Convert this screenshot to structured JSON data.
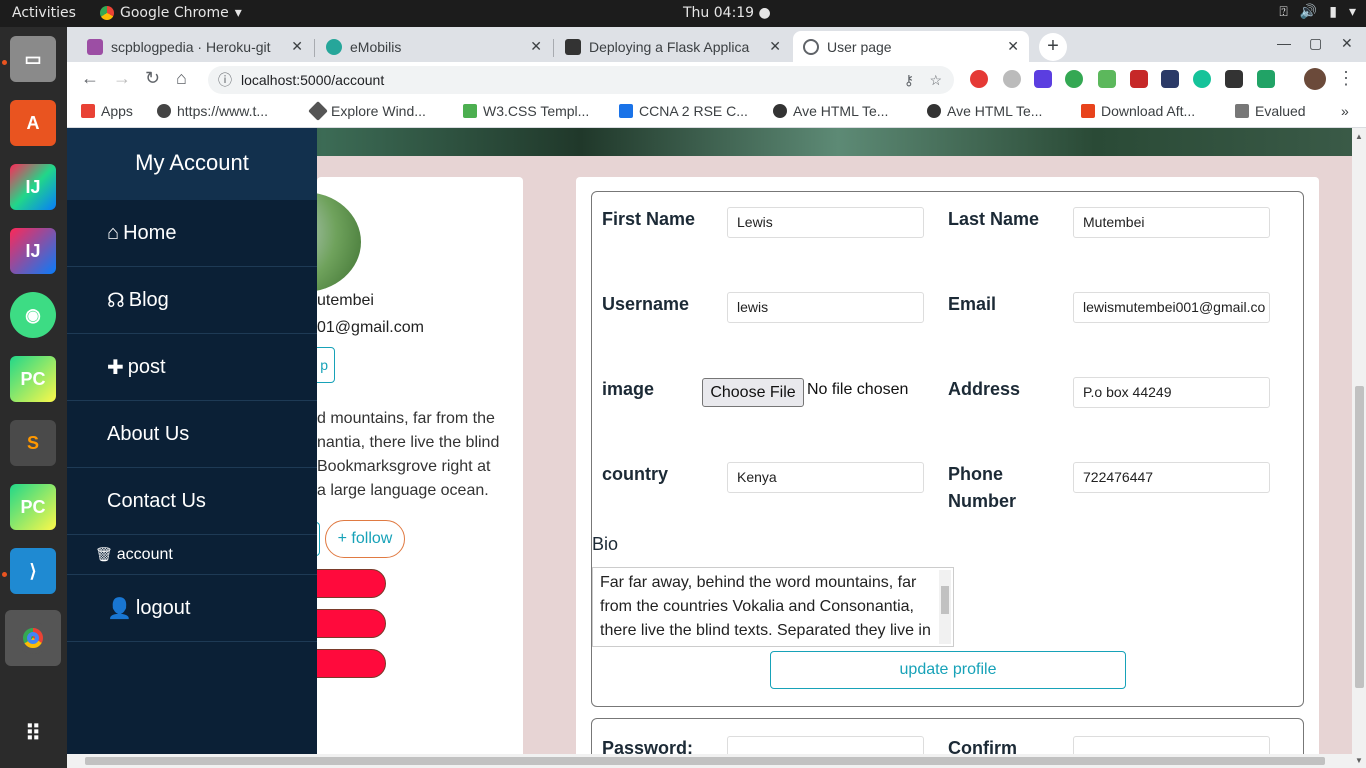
{
  "topbar": {
    "activities": "Activities",
    "app": "Google Chrome",
    "clock": "Thu 04:19"
  },
  "dock": {
    "items": [
      "files-icon",
      "software-center-icon",
      "intellij-icon",
      "intellij-icon-2",
      "android-studio-icon",
      "pycharm-icon",
      "sublime-icon",
      "pycharm-icon-2",
      "vscode-icon",
      "chrome-icon",
      "apps-grid-icon"
    ]
  },
  "tabs": [
    {
      "title": "scpblogpedia · Heroku-git",
      "color": "#9c4ea4"
    },
    {
      "title": "eMobilis",
      "color": "#26a69a"
    },
    {
      "title": "Deploying a Flask Applica",
      "color": "#333333"
    },
    {
      "title": "User page",
      "color": "#5f6368"
    }
  ],
  "address": {
    "url": "localhost:5000/account"
  },
  "bookmarks": [
    {
      "label": "Apps",
      "color": "#e94235"
    },
    {
      "label": "https://www.t...",
      "color": "#444"
    },
    {
      "label": "Explore Wind...",
      "color": "#555"
    },
    {
      "label": "W3.CSS Templ...",
      "color": "#4caf50"
    },
    {
      "label": "CCNA 2 RSE C...",
      "color": "#1a73e8"
    },
    {
      "label": "Ave HTML Te...",
      "color": "#333"
    },
    {
      "label": "Ave HTML Te...",
      "color": "#333"
    },
    {
      "label": "Download Aft...",
      "color": "#e8431c"
    },
    {
      "label": "Evalued",
      "color": "#777"
    }
  ],
  "sidenav": {
    "header": "My Account",
    "items": [
      {
        "label": "Home",
        "icon": "⌂"
      },
      {
        "label": "Blog",
        "icon": "☊"
      },
      {
        "label": "post",
        "icon": "✚"
      },
      {
        "label": "About Us",
        "icon": ""
      },
      {
        "label": "Contact Us",
        "icon": ""
      },
      {
        "label": "account",
        "icon": "🗑"
      },
      {
        "label": "logout",
        "icon": "👤"
      }
    ]
  },
  "profile": {
    "name_fragment": "utembei",
    "email_fragment": "01@gmail.com",
    "button_fragment": "p",
    "bio_lines": [
      "d mountains, far from the",
      "nantia, there live the blind",
      "Bookmarksgrove right at",
      "a large language ocean."
    ],
    "follow": "+ follow"
  },
  "form": {
    "first_name_label": "First Name",
    "first_name": "Lewis",
    "last_name_label": "Last Name",
    "last_name": "Mutembei",
    "username_label": "Username",
    "username": "lewis",
    "email_label": "Email",
    "email": "lewismutembei001@gmail.co",
    "image_label": "image",
    "choose_file": "Choose File",
    "no_file": "No file chosen",
    "address_label": "Address",
    "address": "P.o  box  44249",
    "country_label": "country",
    "country": "Kenya",
    "phone_label": "Phone Number",
    "phone": "722476447",
    "bio_label": "Bio",
    "bio": "Far far away, behind the word mountains, far from the countries Vokalia and Consonantia, there live the blind texts. Separated they live in Bookmarksgrove right at the coast of the",
    "update_button": "update profile"
  },
  "form2": {
    "password_label": "Password:",
    "confirm_label": "Confirm"
  }
}
